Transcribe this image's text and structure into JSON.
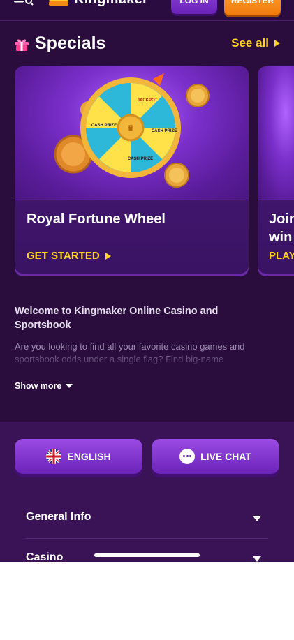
{
  "header": {
    "logo_text": "Kingmaker",
    "login_label": "LOG IN",
    "register_label": "REGISTER"
  },
  "specials": {
    "title": "Specials",
    "see_all_label": "See all",
    "cards": [
      {
        "title": "Royal Fortune Wheel",
        "cta": "GET STARTED"
      },
      {
        "title": "Join win",
        "cta": "PLAY"
      }
    ]
  },
  "welcome": {
    "title": "Welcome to Kingmaker Online Casino and Sportsbook",
    "body": "Are you looking to find all your favorite casino games and sportsbook odds under a single flag? Find big-name",
    "show_more_label": "Show more"
  },
  "footer": {
    "language_label": "ENGLISH",
    "live_chat_label": "LIVE CHAT",
    "accordion": [
      {
        "label": "General Info"
      },
      {
        "label": "Casino"
      }
    ]
  },
  "wheel_labels": [
    "CASH PRIZE",
    "CASH PRIZE",
    "CASH PRIZE",
    "JACKPOT"
  ],
  "colors": {
    "background": "#2a0d3d",
    "accent_yellow": "#ffd21f",
    "register_orange": "#f07a0c",
    "purple_button": "#7a2fcb"
  }
}
